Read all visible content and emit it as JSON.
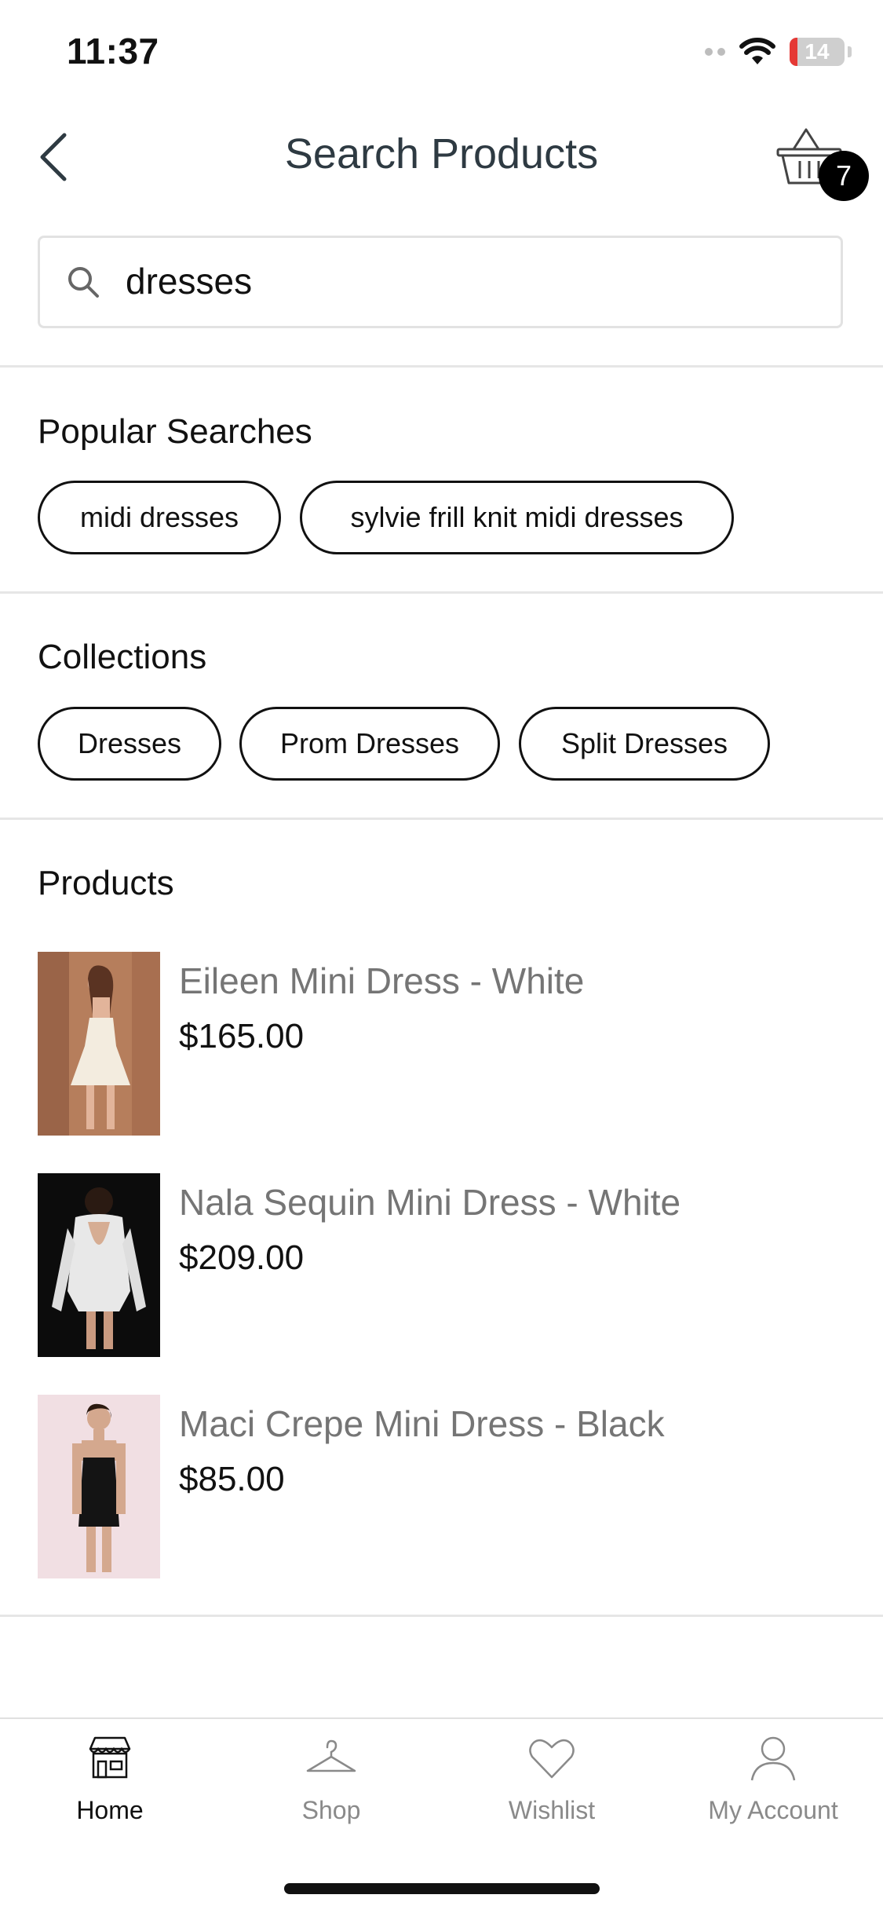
{
  "status_bar": {
    "time": "11:37",
    "battery": "14",
    "battery_level": 0.14,
    "battery_color": "#e53935"
  },
  "header": {
    "title": "Search Products",
    "cart_count": "7"
  },
  "search": {
    "value": "dresses",
    "placeholder": ""
  },
  "popular_searches": {
    "title": "Popular Searches",
    "items": [
      "midi dresses",
      "sylvie frill knit midi dresses"
    ]
  },
  "collections": {
    "title": "Collections",
    "items": [
      "Dresses",
      "Prom Dresses",
      "Split Dresses"
    ]
  },
  "products": {
    "title": "Products",
    "items": [
      {
        "name": "Eileen Mini Dress - White",
        "price": "$165.00"
      },
      {
        "name": "Nala Sequin Mini Dress - White",
        "price": "$209.00"
      },
      {
        "name": "Maci Crepe Mini Dress - Black",
        "price": "$85.00"
      }
    ]
  },
  "tabbar": {
    "items": [
      {
        "label": "Home",
        "icon": "store-icon",
        "active": true
      },
      {
        "label": "Shop",
        "icon": "hanger-icon",
        "active": false
      },
      {
        "label": "Wishlist",
        "icon": "heart-icon",
        "active": false
      },
      {
        "label": "My Account",
        "icon": "user-icon",
        "active": false
      }
    ]
  },
  "colors": {
    "accent": "#000000",
    "text_muted": "#757575",
    "divider": "#e6e6e6"
  }
}
